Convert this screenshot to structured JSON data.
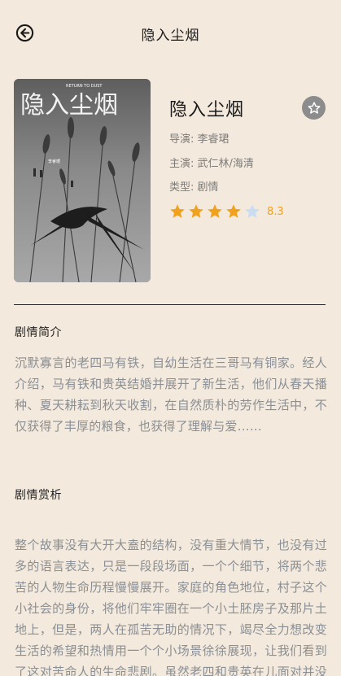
{
  "header": {
    "title": "隐入尘烟",
    "back_icon": "arrow-left-circle-icon"
  },
  "movie": {
    "title": "隐入尘烟",
    "director": "导演: 李睿珺",
    "cast": "主演: 武仁林/海清",
    "genre": "类型: 剧情",
    "rating": 8.3,
    "rating_text": "8.3",
    "stars_max": 5,
    "favorite_icon": "star-outline-icon",
    "poster": {
      "title_art": "隐入尘烟",
      "english_title": "RETURN TO DUST",
      "director_credit": "李睿珺"
    }
  },
  "sections": {
    "synopsis": {
      "title": "剧情简介",
      "text": "沉默寡言的老四马有铁，自幼生活在三哥马有铜家。经人介绍，马有铁和贵英结婚并展开了新生活，他们从春天播种、夏天耕耘到秋天收割，在自然质朴的劳作生活中，不仅获得了丰厚的粮食，也获得了理解与爱……"
    },
    "review": {
      "title": "剧情赏析",
      "text": "整个故事没有大开大盍的结构，没有重大情节，也没有过多的语言表达，只是一段段场面，一个个细节，将两个悲苦的人物生命历程慢慢展开。家庭的角色地位，村子这个小社会的身份，将他们牢牢圈在一个小土胚房子及那片土地上，但是，两人在孤苦无助的情况下，竭尽全力想改变生活的希望和热情用一个个小场景徐徐展现，让我们看到了这对苦命人的生命悲剧。虽然老四和贵英在儿面对并没有表达的机动，但是面"
    }
  },
  "colors": {
    "background": "#f3e9dc",
    "star_filled": "#f0a21f",
    "star_empty": "#c9dcf2",
    "text_muted": "#8a8f96"
  }
}
